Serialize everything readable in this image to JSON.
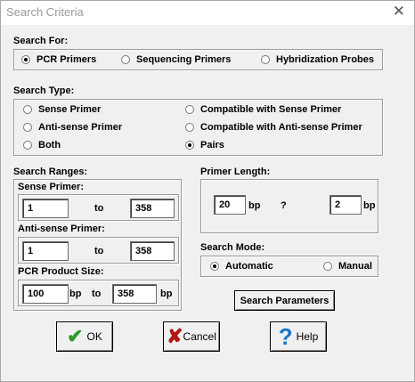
{
  "window": {
    "title": "Search Criteria"
  },
  "search_for": {
    "label": "Search For:",
    "options": [
      {
        "label": "PCR Primers",
        "selected": true
      },
      {
        "label": "Sequencing Primers",
        "selected": false
      },
      {
        "label": "Hybridization Probes",
        "selected": false
      }
    ]
  },
  "search_type": {
    "label": "Search Type:",
    "options": [
      {
        "label": "Sense Primer",
        "selected": false
      },
      {
        "label": "Anti-sense Primer",
        "selected": false
      },
      {
        "label": "Both",
        "selected": false
      },
      {
        "label": "Compatible with Sense Primer",
        "selected": false
      },
      {
        "label": "Compatible with Anti-sense Primer",
        "selected": false
      },
      {
        "label": "Pairs",
        "selected": true
      }
    ]
  },
  "search_ranges": {
    "label": "Search Ranges:",
    "sense": {
      "label": "Sense Primer:",
      "from": "1",
      "to_label": "to",
      "to": "358"
    },
    "antisense": {
      "label": "Anti-sense Primer:",
      "from": "1",
      "to_label": "to",
      "to": "358"
    },
    "pcr": {
      "label": "PCR Product Size:",
      "from": "100",
      "unit1": "bp",
      "to_label": "to",
      "to": "358",
      "unit2": "bp"
    }
  },
  "primer_length": {
    "label": "Primer Length:",
    "value": "20",
    "unit": "bp",
    "separator": "?",
    "tolerance": "2",
    "unit2": "bp"
  },
  "search_mode": {
    "label": "Search Mode:",
    "options": [
      {
        "label": "Automatic",
        "selected": true
      },
      {
        "label": "Manual",
        "selected": false
      }
    ]
  },
  "buttons": {
    "search_parameters": "Search Parameters",
    "ok": "OK",
    "cancel": "Cancel",
    "help": "Help"
  },
  "colors": {
    "ok_check": "#2e9a2e",
    "cancel_x": "#b01818",
    "help_q": "#1b74c9"
  }
}
